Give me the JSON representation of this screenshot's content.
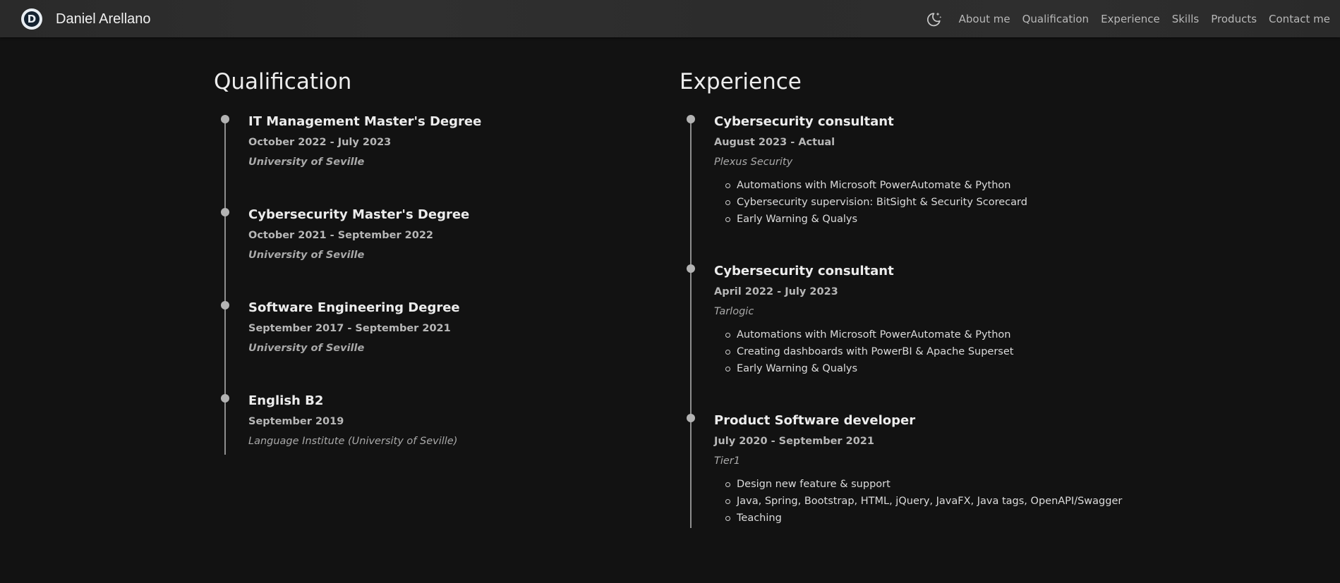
{
  "header": {
    "logo_letter": "D",
    "brand_name": "Daniel Arellano",
    "theme_icon": "moon-stars-icon",
    "nav": [
      "About me",
      "Qualification",
      "Experience",
      "Skills",
      "Products",
      "Contact me"
    ]
  },
  "qualification": {
    "title": "Qualification",
    "items": [
      {
        "title": "IT Management Master's Degree",
        "date": "October 2022 - July 2023",
        "org": "University of Seville"
      },
      {
        "title": "Cybersecurity Master's Degree",
        "date": "October 2021 - September 2022",
        "org": "University of Seville"
      },
      {
        "title": "Software Engineering Degree",
        "date": "September 2017 - September 2021",
        "org": "University of Seville"
      },
      {
        "title": "English B2",
        "date": "September 2019",
        "org": "Language Institute (University of Seville)"
      }
    ]
  },
  "experience": {
    "title": "Experience",
    "items": [
      {
        "title": "Cybersecurity consultant",
        "date": "August 2023 - Actual",
        "org": "Plexus Security",
        "bullets": [
          "Automations with Microsoft PowerAutomate & Python",
          "Cybersecurity supervision: BitSight & Security Scorecard",
          "Early Warning & Qualys"
        ]
      },
      {
        "title": "Cybersecurity consultant",
        "date": "April 2022 - July 2023",
        "org": "Tarlogic",
        "bullets": [
          "Automations with Microsoft PowerAutomate & Python",
          "Creating dashboards with PowerBI & Apache Superset",
          "Early Warning & Qualys"
        ]
      },
      {
        "title": "Product Software developer",
        "date": "July 2020 - September 2021",
        "org": "Tier1",
        "bullets": [
          "Design new feature & support",
          "Java, Spring, Bootstrap, HTML, jQuery, JavaFX, Java tags, OpenAPI/Swagger",
          "Teaching"
        ]
      }
    ]
  },
  "colors": {
    "background": "#121212",
    "header": "#2e2e2e",
    "timeline_line": "#8e8e8e",
    "timeline_dot": "#b3b3b3"
  }
}
